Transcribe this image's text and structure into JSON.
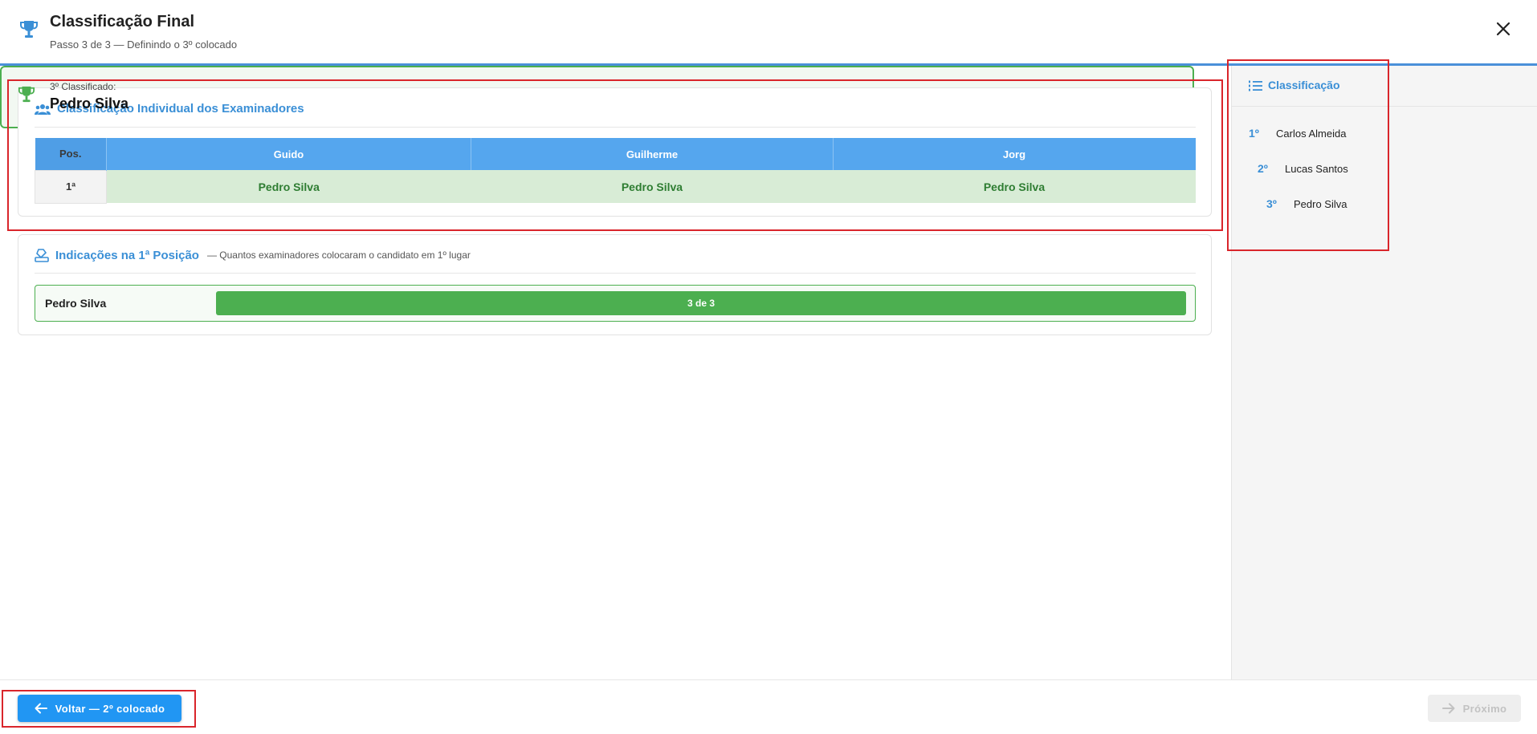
{
  "header": {
    "title": "Classificação Final",
    "subtitle": "Passo 3 de 3 — Definindo o 3º colocado"
  },
  "individual": {
    "title": "Classificação Individual dos Examinadores",
    "pos_header": "Pos.",
    "examiners": [
      "Guido",
      "Guilherme",
      "Jorg"
    ],
    "rows": [
      {
        "pos": "1ª",
        "picks": [
          "Pedro Silva",
          "Pedro Silva",
          "Pedro Silva"
        ]
      }
    ]
  },
  "indications": {
    "title": "Indicações na 1ª Posição",
    "hint": "— Quantos examinadores colocaram o candidato em 1º lugar",
    "items": [
      {
        "name": "Pedro Silva",
        "label": "3 de 3",
        "fraction": 1.0
      }
    ]
  },
  "result": {
    "label": "3º Classificado:",
    "name": "Pedro Silva"
  },
  "sidebar": {
    "title": "Classificação",
    "items": [
      {
        "rank": "1º",
        "name": "Carlos Almeida"
      },
      {
        "rank": "2º",
        "name": "Lucas Santos"
      },
      {
        "rank": "3º",
        "name": "Pedro Silva"
      }
    ]
  },
  "footer": {
    "back_label": "Voltar — 2º colocado",
    "next_label": "Próximo"
  },
  "colors": {
    "accent": "#3a8fd6",
    "table_header": "#55a6ee",
    "success": "#4caf50",
    "button": "#2196f3",
    "annotation": "#d9252b"
  }
}
